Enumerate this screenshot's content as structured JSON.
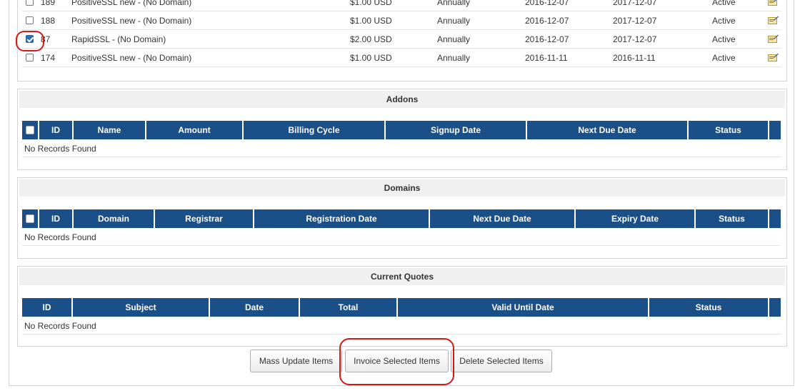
{
  "products": [
    {
      "id": "189",
      "name": "PositiveSSL new - (No Domain)",
      "amount": "$1.00 USD",
      "cycle": "Annually",
      "signup": "2016-12-07",
      "next_due": "2017-12-07",
      "status": "Active",
      "checked": false
    },
    {
      "id": "188",
      "name": "PositiveSSL new - (No Domain)",
      "amount": "$1.00 USD",
      "cycle": "Annually",
      "signup": "2016-12-07",
      "next_due": "2017-12-07",
      "status": "Active",
      "checked": false
    },
    {
      "id": "87",
      "name": "RapidSSL - (No Domain)",
      "amount": "$2.00 USD",
      "cycle": "Annually",
      "signup": "2016-12-07",
      "next_due": "2017-12-07",
      "status": "Active",
      "checked": true
    },
    {
      "id": "174",
      "name": "PositiveSSL new - (No Domain)",
      "amount": "$1.00 USD",
      "cycle": "Annually",
      "signup": "2016-11-11",
      "next_due": "2016-11-11",
      "status": "Active",
      "checked": false
    }
  ],
  "addons": {
    "title": "Addons",
    "headers": [
      "ID",
      "Name",
      "Amount",
      "Billing Cycle",
      "Signup Date",
      "Next Due Date",
      "Status"
    ],
    "empty_text": "No Records Found"
  },
  "domains": {
    "title": "Domains",
    "headers": [
      "ID",
      "Domain",
      "Registrar",
      "Registration Date",
      "Next Due Date",
      "Expiry Date",
      "Status"
    ],
    "empty_text": "No Records Found"
  },
  "quotes": {
    "title": "Current Quotes",
    "headers": [
      "ID",
      "Subject",
      "Date",
      "Total",
      "Valid Until Date",
      "Status"
    ],
    "empty_text": "No Records Found"
  },
  "actions": {
    "mass_update": "Mass Update Items",
    "invoice_selected": "Invoice Selected Items",
    "delete_selected": "Delete Selected Items"
  },
  "colors": {
    "header_bg": "#1b4f88",
    "annotation": "#d11a1a"
  }
}
